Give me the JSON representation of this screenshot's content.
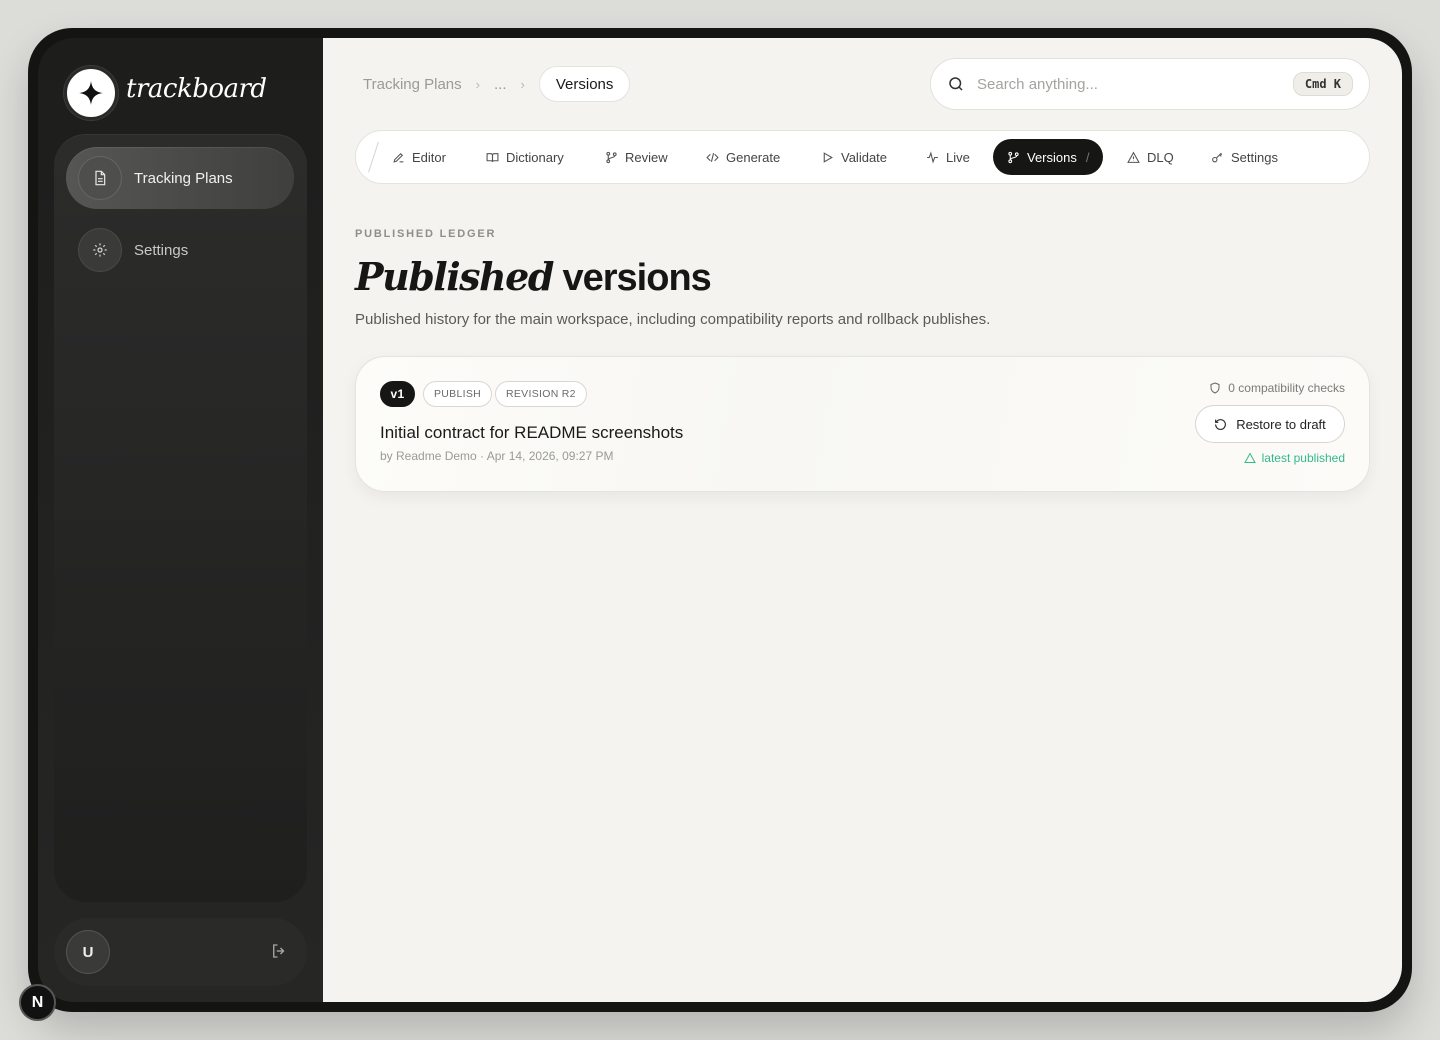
{
  "brand": {
    "name": "trackboard"
  },
  "sidebar": {
    "items": [
      {
        "label": "Tracking Plans",
        "icon": "document-icon",
        "active": true
      },
      {
        "label": "Settings",
        "icon": "gear-icon",
        "active": false
      }
    ],
    "user_initial": "U",
    "dev_badge": "N"
  },
  "breadcrumb": {
    "root": "Tracking Plans",
    "ellipsis": "...",
    "current": "Versions"
  },
  "search": {
    "placeholder": "Search anything...",
    "shortcut": "Cmd K"
  },
  "tabs": [
    {
      "label": "Editor",
      "icon": "pencil-icon"
    },
    {
      "label": "Dictionary",
      "icon": "book-icon"
    },
    {
      "label": "Review",
      "icon": "branch-icon"
    },
    {
      "label": "Generate",
      "icon": "code-icon"
    },
    {
      "label": "Validate",
      "icon": "play-icon"
    },
    {
      "label": "Live",
      "icon": "activity-icon"
    },
    {
      "label": "Versions",
      "icon": "branch-icon",
      "active": true
    },
    {
      "label": "DLQ",
      "icon": "warning-icon"
    },
    {
      "label": "Settings",
      "icon": "key-icon"
    }
  ],
  "page": {
    "eyebrow": "PUBLISHED LEDGER",
    "title_italic": "Published",
    "title_plain": "versions",
    "subtitle": "Published history for the main workspace, including compatibility reports and rollback publishes."
  },
  "versions": [
    {
      "version": "v1",
      "kind": "PUBLISH",
      "revision": "REVISION R2",
      "title": "Initial contract for README screenshots",
      "meta": "by Readme Demo · Apr 14, 2026, 09:27 PM",
      "checks": "0 compatibility checks",
      "restore_label": "Restore to draft",
      "status": "latest published"
    }
  ],
  "colors": {
    "accent_dark": "#161615",
    "success": "#34b98a",
    "background": "#f4f3f0"
  }
}
